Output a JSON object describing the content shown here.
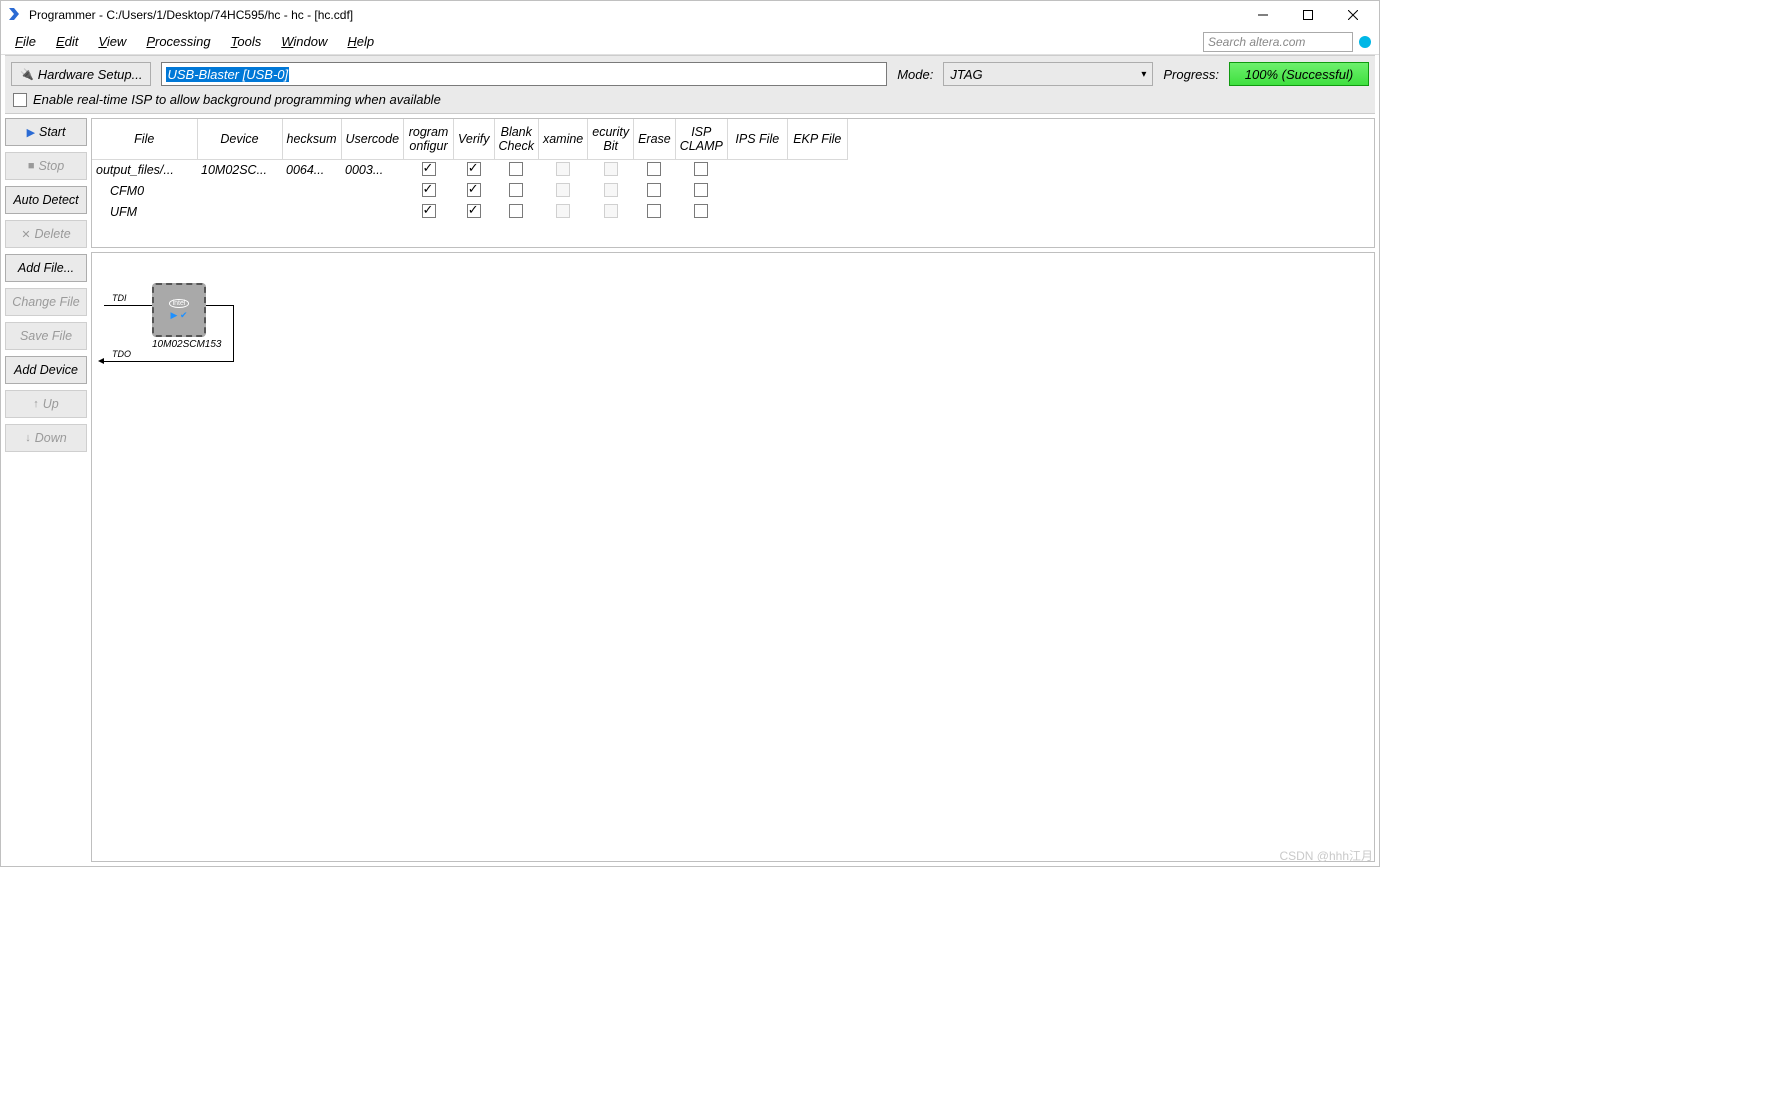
{
  "titlebar": {
    "title": "Programmer - C:/Users/1/Desktop/74HC595/hc - hc - [hc.cdf]"
  },
  "menubar": {
    "file": "File",
    "edit": "Edit",
    "view": "View",
    "processing": "Processing",
    "tools": "Tools",
    "window": "Window",
    "help": "Help",
    "search_placeholder": "Search altera.com"
  },
  "toolbar": {
    "hw_setup": "Hardware Setup...",
    "hw_value": "USB-Blaster [USB-0]",
    "mode_label": "Mode:",
    "mode_value": "JTAG",
    "progress_label": "Progress:",
    "progress_value": "100% (Successful)",
    "enable_isp": "Enable real-time ISP to allow background programming when available"
  },
  "sidebar": {
    "start": "Start",
    "stop": "Stop",
    "autodetect": "Auto Detect",
    "delete": "Delete",
    "addfile": "Add File...",
    "changefile": "Change File",
    "savefile": "Save File",
    "adddevice": "Add Device",
    "up": "Up",
    "down": "Down"
  },
  "table": {
    "headers": {
      "file": "File",
      "device": "Device",
      "checksum": "hecksum",
      "usercode": "Usercode",
      "program": "rogram onfigur",
      "verify": "Verify",
      "blank": "Blank Check",
      "examine": "xamine",
      "security": "ecurity Bit",
      "erase": "Erase",
      "isp": "ISP CLAMP",
      "ips": "IPS File",
      "ekp": "EKP File"
    },
    "rows": [
      {
        "file": "output_files/...",
        "device": "10M02SC...",
        "checksum": "0064...",
        "usercode": "0003...",
        "prog": true,
        "verify": true,
        "blank": false,
        "examine": "dis",
        "security": "dis",
        "erase": false,
        "isp": false
      },
      {
        "file": "CFM0",
        "device": "",
        "checksum": "",
        "usercode": "",
        "prog": true,
        "verify": true,
        "blank": false,
        "examine": "dis",
        "security": "dis",
        "erase": false,
        "isp": false
      },
      {
        "file": "UFM",
        "device": "",
        "checksum": "",
        "usercode": "",
        "prog": true,
        "verify": true,
        "blank": false,
        "examine": "dis",
        "security": "dis",
        "erase": false,
        "isp": false
      }
    ]
  },
  "diagram": {
    "tdi": "TDI",
    "tdo": "TDO",
    "device": "10M02SCM153",
    "brand": "intel"
  },
  "watermark": "CSDN @hhh江月"
}
